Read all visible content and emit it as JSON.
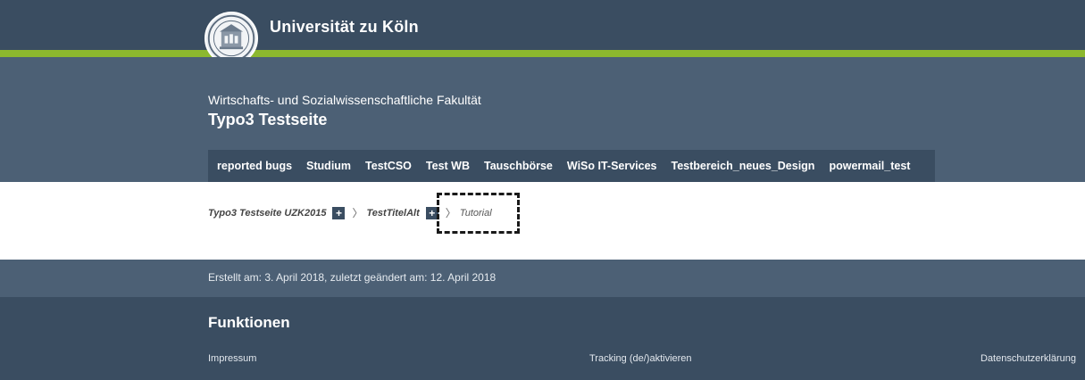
{
  "header": {
    "university_name": "Universität zu Köln",
    "logo": "university-seal-icon",
    "colors": {
      "header_bg": "#3a4d61",
      "accent_line": "#8cb82e",
      "faculty_bg": "#4c6075"
    }
  },
  "faculty": {
    "name": "Wirtschafts- und Sozialwissenschaftliche Fakultät",
    "site_title": "Typo3 Testseite"
  },
  "nav": {
    "items": [
      {
        "label": "reported bugs"
      },
      {
        "label": "Studium"
      },
      {
        "label": "TestCSO"
      },
      {
        "label": "Test WB"
      },
      {
        "label": "Tauschbörse"
      },
      {
        "label": "WiSo IT-Services"
      },
      {
        "label": "Testbereich_neues_Design"
      },
      {
        "label": "powermail_test"
      }
    ]
  },
  "breadcrumb": {
    "items": [
      {
        "label": "Typo3 Testseite UZK2015",
        "expand": "+"
      },
      {
        "label": "TestTitelAlt",
        "expand": "+"
      },
      {
        "label": "Tutorial"
      }
    ],
    "separator": "〉"
  },
  "meta": {
    "text": "Erstellt am:  3. April 2018, zuletzt geändert am: 12. April 2018"
  },
  "footer": {
    "title": "Funktionen",
    "links": {
      "impressum": "Impressum",
      "tracking": "Tracking (de/)aktivieren",
      "datenschutz": "Datenschutzerklärung"
    }
  }
}
